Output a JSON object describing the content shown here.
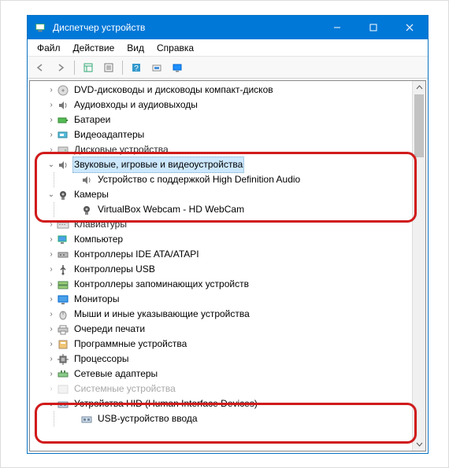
{
  "window": {
    "title": "Диспетчер устройств"
  },
  "menu": {
    "file": "Файл",
    "action": "Действие",
    "view": "Вид",
    "help": "Справка"
  },
  "tree": {
    "dvd": "DVD-дисководы и дисководы компакт-дисков",
    "audio_io": "Аудиовходы и аудиовыходы",
    "batteries": "Батареи",
    "video_adapters": "Видеоадаптеры",
    "disk_devices": "Дисковые устройства",
    "sound_game_video": "Звуковые, игровые и видеоустройства",
    "hd_audio": "Устройство с поддержкой High Definition Audio",
    "cameras": "Камеры",
    "webcam": "VirtualBox Webcam - HD WebCam",
    "keyboards": "Клавиатуры",
    "computer": "Компьютер",
    "ide_ata": "Контроллеры IDE ATA/ATAPI",
    "usb_ctrl": "Контроллеры USB",
    "storage_ctrl": "Контроллеры запоминающих устройств",
    "monitors": "Мониторы",
    "mice": "Мыши и иные указывающие устройства",
    "print_queues": "Очереди печати",
    "software": "Программные устройства",
    "processors": "Процессоры",
    "net_adapters": "Сетевые адаптеры",
    "sys_devices_cut": "Системные устройства",
    "hid": "Устройства HID (Human Interface Devices)",
    "usb_input": "USB-устройство ввода"
  }
}
